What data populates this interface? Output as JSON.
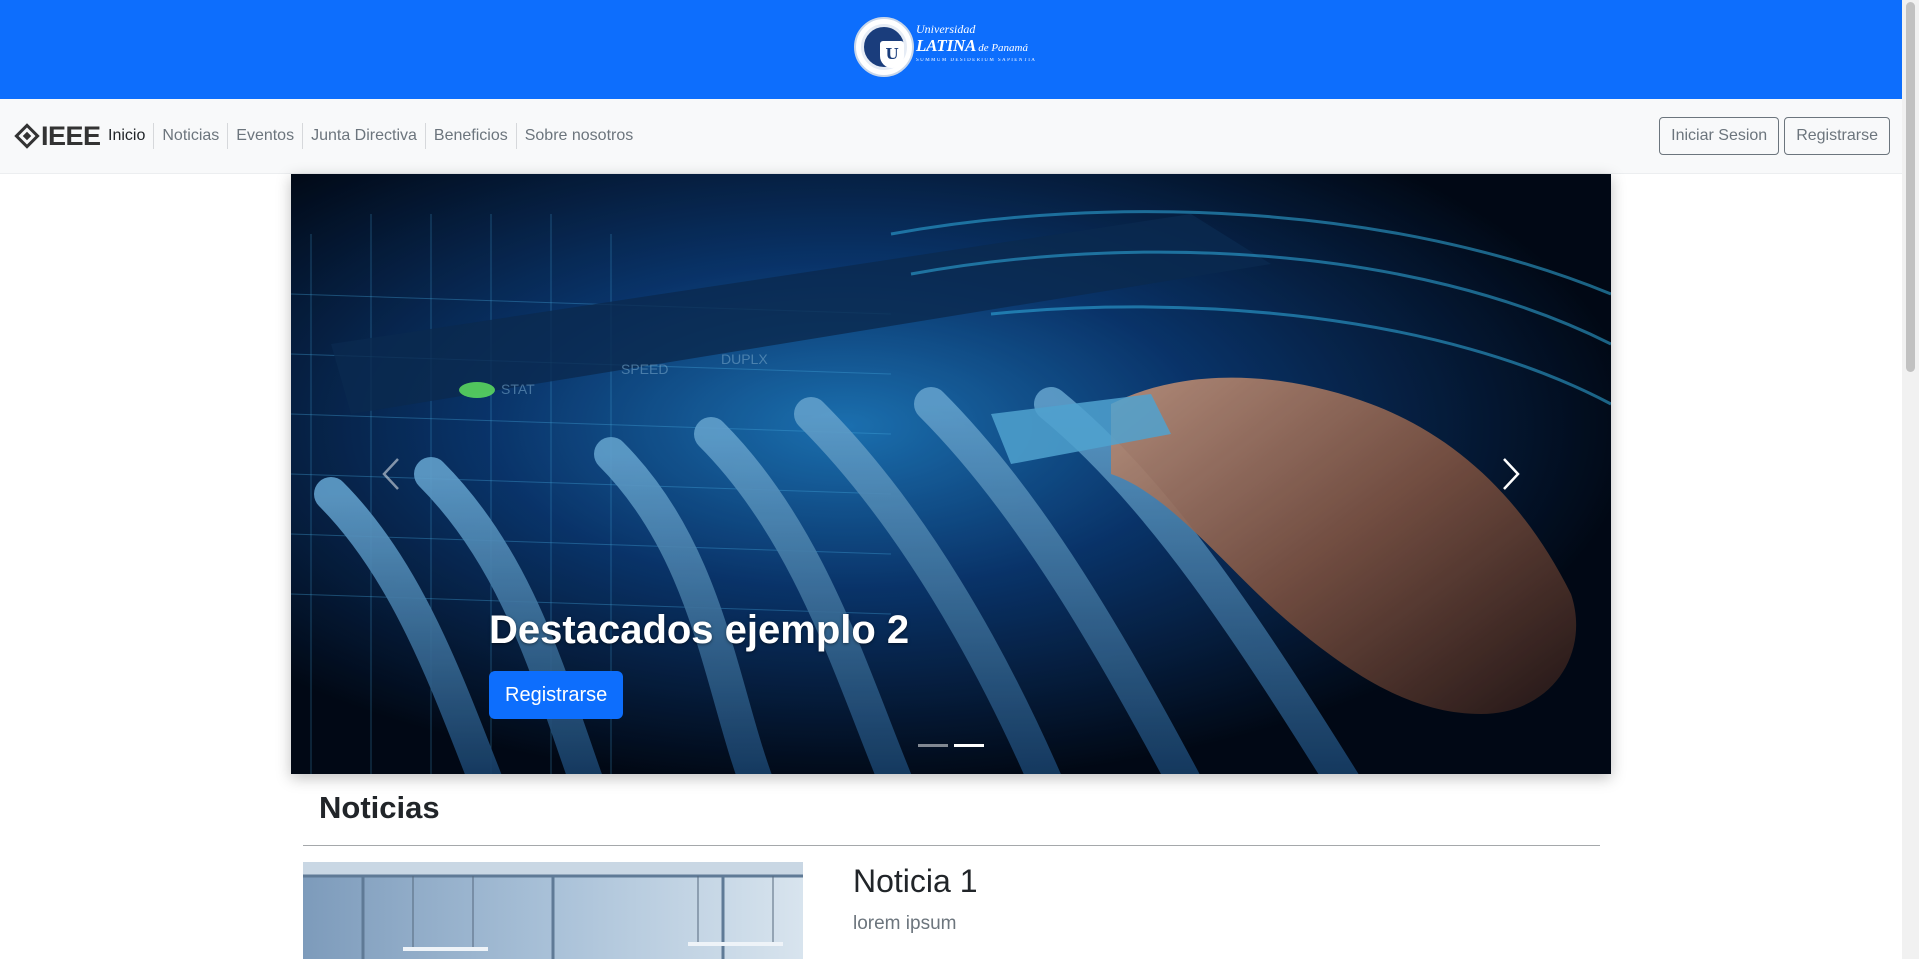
{
  "header": {
    "logo": {
      "line1": "Universidad",
      "line2": "LATINA",
      "line2b": "de Panamá",
      "motto": "SUMMUM DESIDERIUM SAPIENTIA",
      "seal_letter": "U"
    }
  },
  "navbar": {
    "brand": "IEEE",
    "links": [
      "Inicio",
      "Noticias",
      "Eventos",
      "Junta Directiva",
      "Beneficios",
      "Sobre nosotros"
    ],
    "login_label": "Iniciar Sesion",
    "register_label": "Registrarse"
  },
  "carousel": {
    "slide_title": "Destacados ejemplo 2",
    "slide_button": "Registrarse",
    "slide_count": 2,
    "active_slide": 2
  },
  "news": {
    "section_title": "Noticias",
    "items": [
      {
        "title": "Noticia 1",
        "text": "lorem ipsum"
      }
    ]
  },
  "colors": {
    "primary": "#0d6efd",
    "navbar_bg": "#f8f9fa",
    "muted_text": "#6c757d"
  }
}
